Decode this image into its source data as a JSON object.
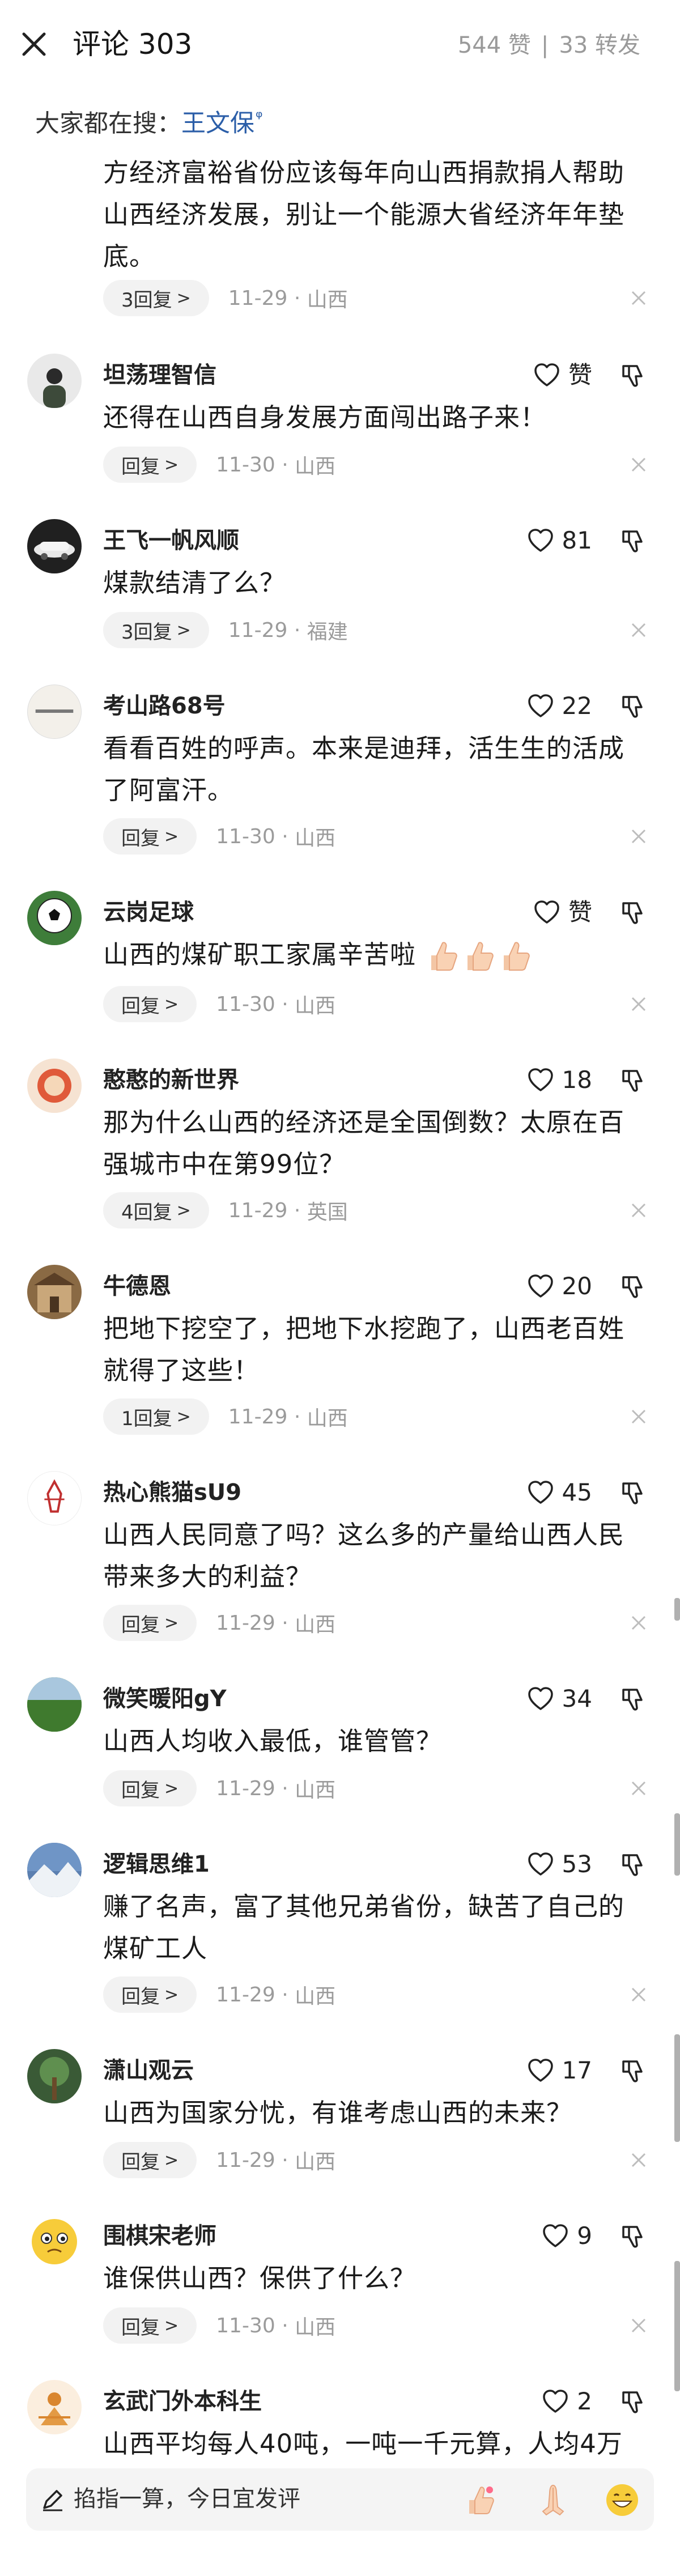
{
  "header": {
    "title": "评论 303",
    "likes": "544 赞",
    "reposts": "33 转发"
  },
  "search": {
    "prefix": "大家都在搜：",
    "term": "王文保"
  },
  "partial_comment": {
    "text": "方经济富裕省份应该每年向山西捐款捐人帮助山西经济发展，别让一个能源大省经济年年垫底。",
    "reply_label": "3回复",
    "time": "11-29",
    "location": "山西"
  },
  "comments": [
    {
      "username": "坦荡理智信",
      "likes": "赞",
      "text": "还得在山西自身发展方面闯出路子来！",
      "reply_label": "回复",
      "time": "11-30",
      "location": "山西"
    },
    {
      "username": "王飞一帆风顺",
      "likes": "81",
      "text": "煤款结清了么？",
      "reply_label": "3回复",
      "time": "11-29",
      "location": "福建"
    },
    {
      "username": "考山路68号",
      "likes": "22",
      "text": "看看百姓的呼声。本来是迪拜，活生生的活成了阿富汗。",
      "reply_label": "回复",
      "time": "11-30",
      "location": "山西"
    },
    {
      "username": "云岗足球",
      "likes": "赞",
      "text": "山西的煤矿职工家属辛苦啦",
      "reply_label": "回复",
      "time": "11-30",
      "location": "山西"
    },
    {
      "username": "憨憨的新世界",
      "likes": "18",
      "text": "那为什么山西的经济还是全国倒数？太原在百强城市中在第99位？",
      "reply_label": "4回复",
      "time": "11-29",
      "location": "英国"
    },
    {
      "username": "牛德恩",
      "likes": "20",
      "text": "把地下挖空了，把地下水挖跑了，山西老百姓就得了这些！",
      "reply_label": "1回复",
      "time": "11-29",
      "location": "山西"
    },
    {
      "username": "热心熊猫sU9",
      "likes": "45",
      "text": "山西人民同意了吗？这么多的产量给山西人民带来多大的利益？",
      "reply_label": "回复",
      "time": "11-29",
      "location": "山西"
    },
    {
      "username": "微笑暖阳gY",
      "likes": "34",
      "text": "山西人均收入最低，谁管管？",
      "reply_label": "回复",
      "time": "11-29",
      "location": "山西"
    },
    {
      "username": "逻辑思维1",
      "likes": "53",
      "text": "赚了名声，富了其他兄弟省份，缺苦了自己的煤矿工人",
      "reply_label": "回复",
      "time": "11-29",
      "location": "山西"
    },
    {
      "username": "潇山观云",
      "likes": "17",
      "text": "山西为国家分忧，有谁考虑山西的未来？",
      "reply_label": "回复",
      "time": "11-29",
      "location": "山西"
    },
    {
      "username": "围棋宋老师",
      "likes": "9",
      "text": "谁保供山西？保供了什么？",
      "reply_label": "回复",
      "time": "11-30",
      "location": "山西"
    },
    {
      "username": "玄武门外本科生",
      "likes": "2",
      "text": "山西平均每人40吨，一吨一千元算，人均4万"
    }
  ],
  "bottom": {
    "placeholder": "掐指一算，今日宜发评"
  },
  "icons": [
    "close-icon",
    "heart-icon",
    "thumb-down-icon",
    "dismiss-icon",
    "pen-icon",
    "thumbs-up-emoji",
    "namaste-emoji",
    "grin-emoji"
  ],
  "colors": {
    "link": "#2b5ea8",
    "muted": "#9b9b9b",
    "pill": "#f2f2f2"
  }
}
